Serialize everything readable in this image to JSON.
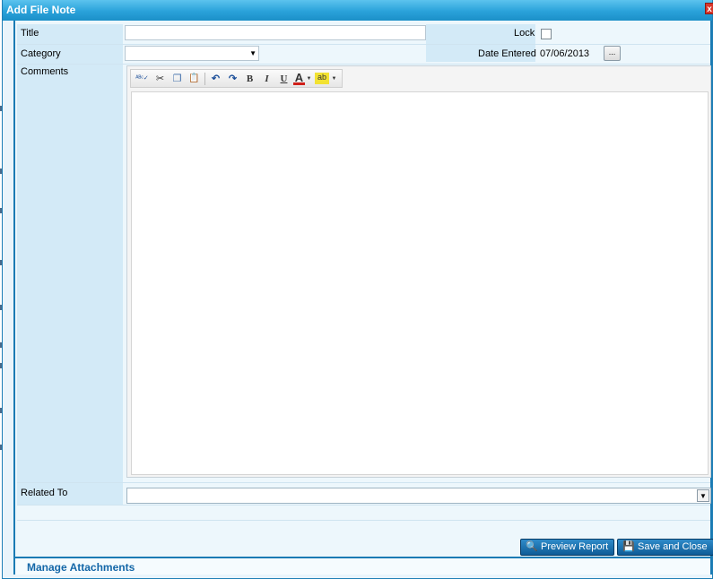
{
  "window": {
    "title": "Add File Note",
    "close_glyph": "x"
  },
  "form": {
    "title_label": "Title",
    "title_value": "",
    "lock_label": "Lock",
    "lock_checked": false,
    "category_label": "Category",
    "category_value": "",
    "date_label": "Date Entered",
    "date_value": "07/06/2013",
    "date_picker_label": "...",
    "comments_label": "Comments",
    "related_label": "Related To",
    "related_value": ""
  },
  "toolbar": {
    "spell_glyph": "ᴬᴮᶜ✓",
    "cut_glyph": "✂",
    "copy_glyph": "❐",
    "paste_glyph": "📋",
    "undo_glyph": "↶",
    "redo_glyph": "↷",
    "bold_label": "B",
    "italic_label": "I",
    "underline_label": "U",
    "font_color_label": "A",
    "highlight_label": "ab",
    "font_color": "#d0201a",
    "highlight_color": "#f2e232"
  },
  "actions": {
    "preview_label": "Preview Report",
    "save_label": "Save and Close"
  },
  "footer": {
    "attachments_label": "Manage Attachments"
  },
  "colors": {
    "titlebar": "#2aa2da",
    "accent": "#1a7bb4",
    "label_bg": "#d3eaf7",
    "button": "#0e5c97"
  }
}
